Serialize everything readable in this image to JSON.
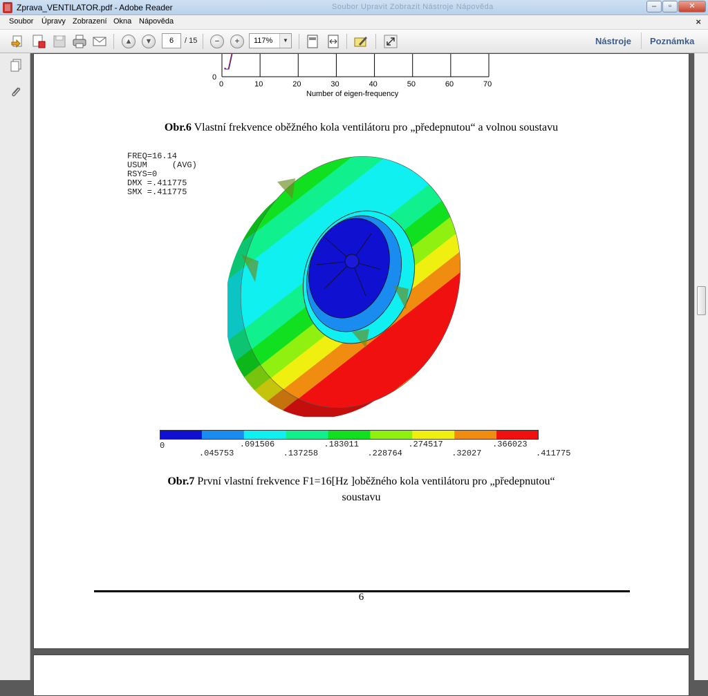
{
  "window": {
    "title": "Zprava_VENTILATOR.pdf - Adobe Reader",
    "ghost_menu": "Soubor   Upravit   Zobrazit   Nástroje   Nápověda"
  },
  "menu": [
    "Soubor",
    "Úpravy",
    "Zobrazení",
    "Okna",
    "Nápověda"
  ],
  "toolbar": {
    "page_current": "6",
    "page_total": "/ 15",
    "zoom": "117%",
    "tools_link": "Nástroje",
    "comment_link": "Poznámka"
  },
  "colors": {
    "accent_link": "#3b5e8e",
    "plot_line_blue": "#2020c0",
    "plot_line_red": "#c02020"
  },
  "plot": {
    "xlabel": "Number of eigen-frequency",
    "x_ticks": [
      "0",
      "10",
      "20",
      "30",
      "40",
      "50",
      "60",
      "70"
    ],
    "y_tick": "0"
  },
  "caption6": {
    "bold": "Obr.6",
    "text": " Vlastní frekvence oběžného kola ventilátoru pro „předepnutou“ a volnou soustavu"
  },
  "fea": {
    "stats": [
      "FREQ=16.14",
      "USUM     (AVG)",
      "RSYS=0",
      "DMX =.411775",
      "SMX =.411775"
    ],
    "legend_colors": [
      "#1010d0",
      "#1a8cf0",
      "#10f0f0",
      "#10f08c",
      "#10e020",
      "#90f010",
      "#f0f010",
      "#f08c10",
      "#f01010"
    ],
    "legend_top": [
      "0",
      ".091506",
      ".183011",
      ".274517",
      ".366023"
    ],
    "legend_bottom": [
      ".045753",
      ".137258",
      ".228764",
      ".32027",
      ".411775"
    ]
  },
  "caption7": {
    "bold": "Obr.7",
    "text": " První vlastní frekvence F1=16[Hz ]oběžného kola ventilátoru pro „předepnutou“",
    "line2": "soustavu"
  },
  "page_number": "6"
}
